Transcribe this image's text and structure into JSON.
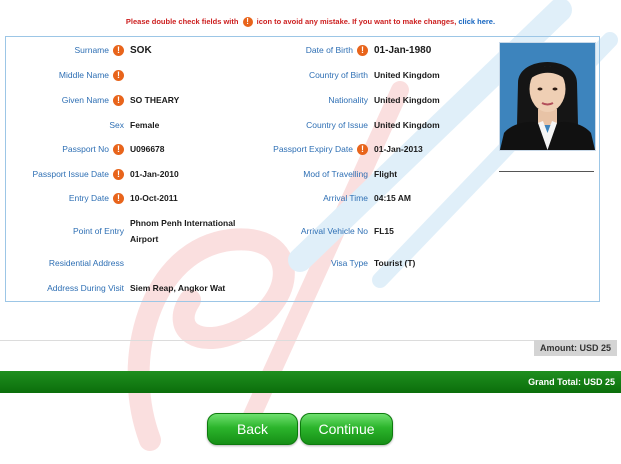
{
  "notice": {
    "before_icon": "Please double check fields with",
    "after_icon": "icon to avoid any mistake. If you want to make changes,",
    "link": "click here."
  },
  "left_fields": [
    {
      "label": "Surname",
      "value": "SOK",
      "warn": true
    },
    {
      "label": "Middle Name",
      "value": "",
      "warn": true
    },
    {
      "label": "Given Name",
      "value": "SO THEARY",
      "warn": true
    },
    {
      "label": "Sex",
      "value": "Female",
      "warn": false
    },
    {
      "label": "Passport No",
      "value": "U096678",
      "warn": true
    },
    {
      "label": "Passport Issue Date",
      "value": "01-Jan-2010",
      "warn": true
    },
    {
      "label": "Entry Date",
      "value": "10-Oct-2011",
      "warn": true
    },
    {
      "label": "Point of Entry",
      "value_line1": "Phnom Penh International",
      "value_line2": "Airport",
      "warn": false
    },
    {
      "label": "Residential Address",
      "value": "",
      "warn": false
    },
    {
      "label": "Address During Visit",
      "value": "Siem Reap, Angkor Wat",
      "warn": false
    }
  ],
  "right_fields": [
    {
      "label": "Date of Birth",
      "value": "01-Jan-1980",
      "warn": true
    },
    {
      "label": "Country of Birth",
      "value": "United Kingdom",
      "warn": false
    },
    {
      "label": "Nationality",
      "value": "United Kingdom",
      "warn": false
    },
    {
      "label": "Country of Issue",
      "value": "United Kingdom",
      "warn": false
    },
    {
      "label": "Passport Expiry Date",
      "value": "01-Jan-2013",
      "warn": true
    },
    {
      "label": "Mod of Travelling",
      "value": "Flight",
      "warn": false
    },
    {
      "label": "Arrival Time",
      "value": "04:15 AM",
      "warn": false
    },
    {
      "label": "Arrival Vehicle No",
      "value": "FL15",
      "warn": false
    },
    {
      "label": "Visa Type",
      "value": "Tourist (T)",
      "warn": false
    }
  ],
  "warn_glyph": "!",
  "amount": "Amount: USD 25",
  "grand_total": "Grand Total: USD 25",
  "buttons": {
    "back": "Back",
    "continue": "Continue"
  },
  "icons": {
    "warning": "warning-icon"
  },
  "colors": {
    "label": "#2e6fb4",
    "warning": "#e8641b",
    "notice": "#cc1f1f",
    "green": "#0b6e0b"
  }
}
